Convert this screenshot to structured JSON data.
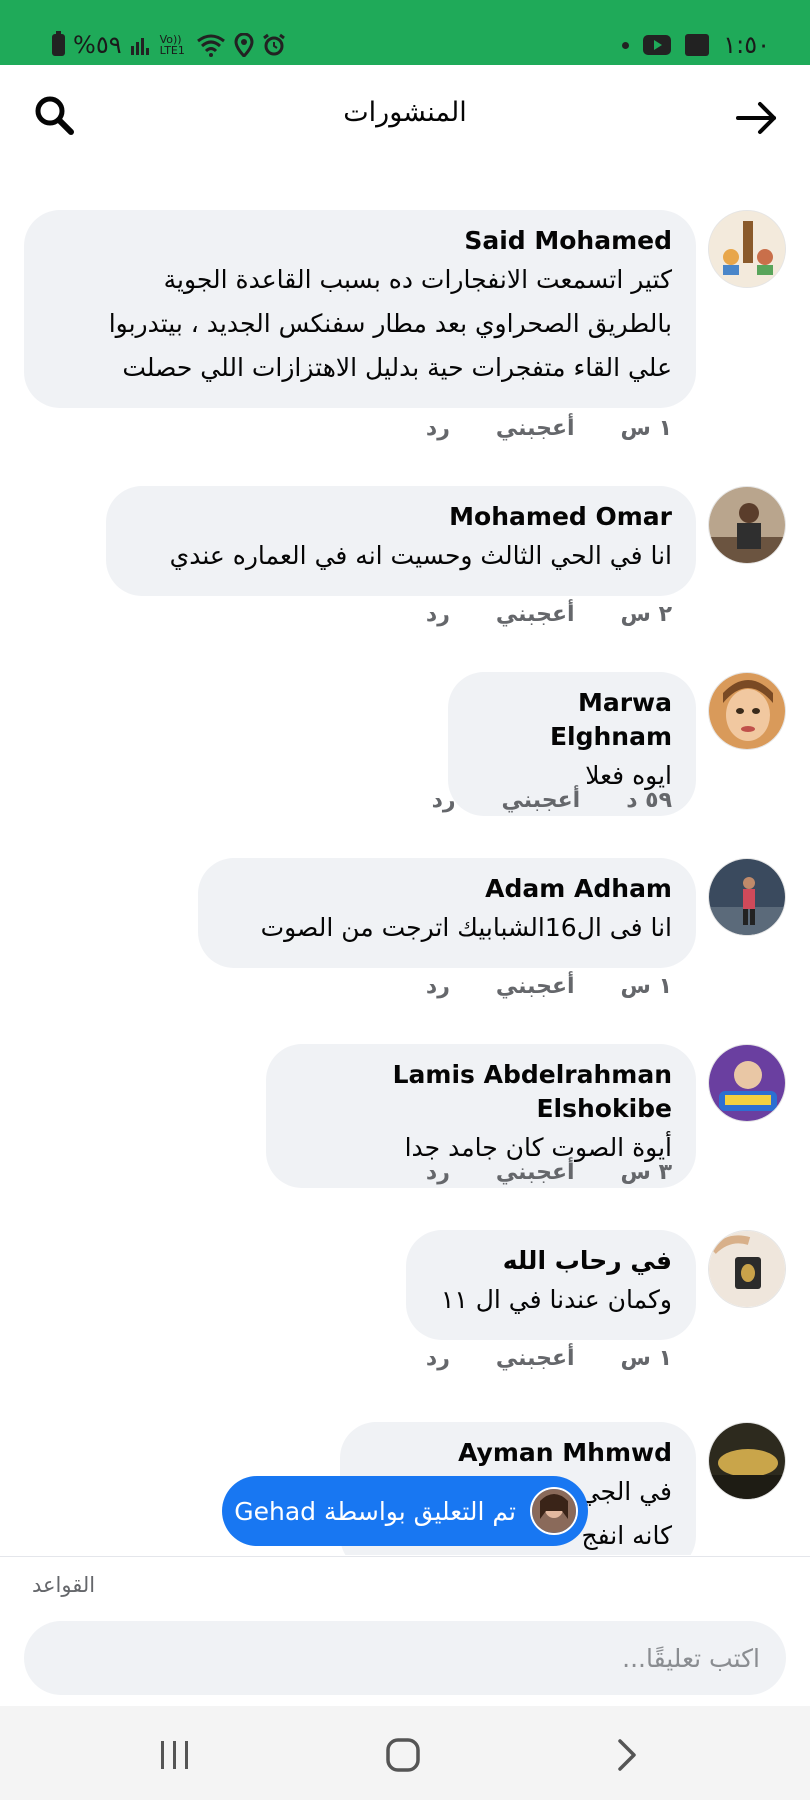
{
  "status_bar": {
    "battery_text": "%٥٩",
    "volte_text": "Vo)) LTE1",
    "time": "١:٥٠"
  },
  "header": {
    "title": "المنشورات"
  },
  "comments": [
    {
      "name": "Said Mohamed",
      "text": "كتير اتسمعت الانفجارات ده بسبب القاعدة الجوية\nبالطريق الصحراوي بعد مطار سفنكس الجديد ، بيتدربوا\nعلي القاء متفجرات حية بدليل الاهتزازات اللي حصلت",
      "time": "١ س",
      "like": "أعجبني",
      "reply": "رد"
    },
    {
      "name": "Mohamed Omar",
      "text": "انا في الحي الثالث وحسيت انه في العماره عندي",
      "time": "٢ س",
      "like": "أعجبني",
      "reply": "رد"
    },
    {
      "name": "Marwa Elghnam",
      "text": "ايوه فعلا",
      "time": "٥٩ د",
      "like": "أعجبني",
      "reply": "رد"
    },
    {
      "name": "Adam Adham",
      "text": "انا فى ال16الشبابيك اترجت من الصوت",
      "time": "١ س",
      "like": "أعجبني",
      "reply": "رد"
    },
    {
      "name": "Lamis Abdelrahman Elshokibe",
      "text": "أيوة الصوت كان جامد جدا",
      "time": "٣ س",
      "like": "أعجبني",
      "reply": "رد"
    },
    {
      "name": "في رحاب الله",
      "text": "وكمان عندنا في ال ١١",
      "time": "١ س",
      "like": "أعجبني",
      "reply": "رد"
    },
    {
      "name": "Ayman Mhmwd",
      "text": "في الجي\nكانه انفج",
      "time": "",
      "like": "",
      "reply": ""
    }
  ],
  "toast": {
    "text": "تم التعليق بواسطة Gehad"
  },
  "footer": {
    "rules_label": "القواعد",
    "input_placeholder": "اكتب تعليقًا..."
  },
  "colors": {
    "status_bar": "#1faa59",
    "bubble": "#f0f2f5",
    "toast": "#1877f2"
  }
}
